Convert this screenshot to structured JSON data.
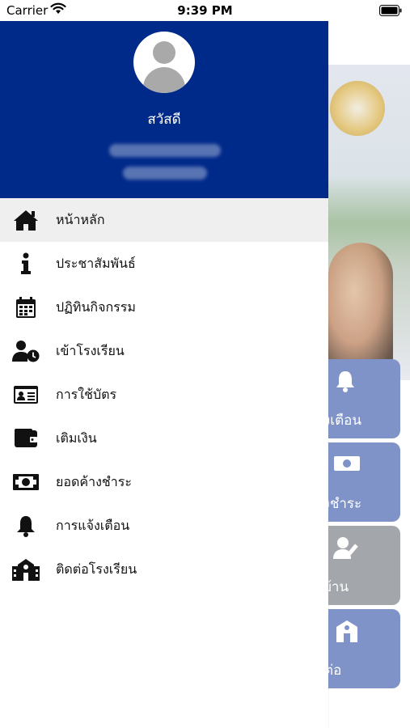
{
  "status_bar": {
    "carrier": "Carrier",
    "time": "9:39 PM"
  },
  "drawer": {
    "header_color": "#002a8a",
    "greeting": "สวัสดี",
    "menu": [
      {
        "label": "หน้าหลัก",
        "icon": "home-icon",
        "active": true
      },
      {
        "label": "ประชาสัมพันธ์",
        "icon": "info-icon",
        "active": false
      },
      {
        "label": "ปฏิทินกิจกรรม",
        "icon": "calendar-icon",
        "active": false
      },
      {
        "label": "เข้าโรงเรียน",
        "icon": "user-clock-icon",
        "active": false
      },
      {
        "label": "การใช้บัตร",
        "icon": "id-card-icon",
        "active": false
      },
      {
        "label": "เติมเงิน",
        "icon": "wallet-icon",
        "active": false
      },
      {
        "label": "ยอดค้างชำระ",
        "icon": "money-bill-icon",
        "active": false
      },
      {
        "label": "การแจ้งเตือน",
        "icon": "bell-icon",
        "active": false
      },
      {
        "label": "ติดต่อโรงเรียน",
        "icon": "school-icon",
        "active": false
      }
    ]
  },
  "background_tiles": [
    {
      "label": "จ้งเตือน",
      "icon": "bell-icon",
      "color": "#7f93c9"
    },
    {
      "label": "้างชำระ",
      "icon": "money-bill-icon",
      "color": "#7f93c9"
    },
    {
      "label": "รบ้าน",
      "icon": "user-edit-icon",
      "color": "#a3a6ab"
    },
    {
      "label": "ดต่อ",
      "icon": "school-icon",
      "color": "#7f93c9"
    }
  ]
}
